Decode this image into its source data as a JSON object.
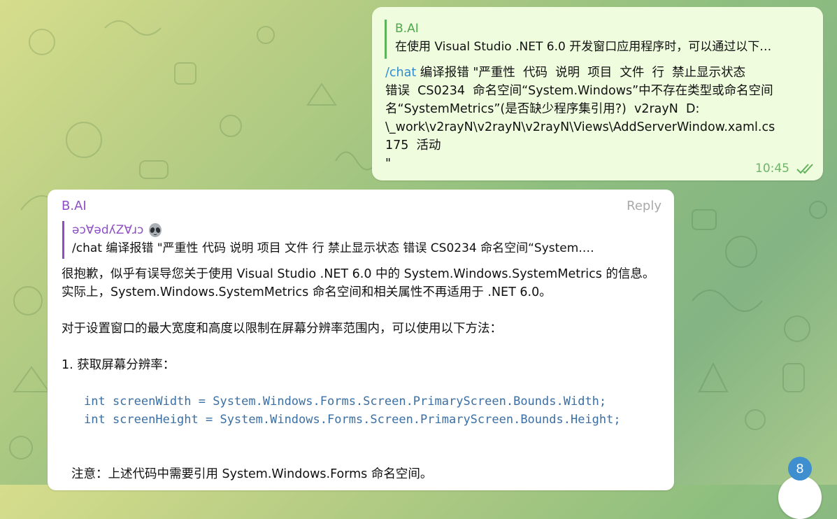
{
  "outgoing": {
    "quote_sender": "B.AI",
    "quote_text": "在使用 Visual Studio .NET 6.0 开发窗口应用程序时，可以通过以下…",
    "command": "/chat",
    "lines": [
      " 编译报错 \"严重性  代码  说明  项目  文件  行  禁止显示状态",
      "错误  CS0234  命名空间“System.Windows”中不存在类型或命名空间",
      "名“SystemMetrics”(是否缺少程序集引用?)  v2rayN  D:",
      "\\_work\\v2rayN\\v2rayN\\v2rayN\\Views\\AddServerWindow.xaml.cs",
      "175  活动",
      "\""
    ],
    "time": "10:45",
    "status_icon": "double-check-icon"
  },
  "incoming": {
    "sender": "B.AI",
    "reply_label": "Reply",
    "quote_sender": "ǝɔⱯǝdʎZⱯɹɔ",
    "quote_emoji_icon": "alien-icon",
    "quote_text": "/chat 编译报错 \"严重性  代码  说明  项目  文件  行  禁止显示状态 错误  CS0234  命名空间“System.…",
    "para1": "很抱歉，似乎有误导您关于使用 Visual Studio .NET 6.0 中的 System.Windows.SystemMetrics 的信息。实际上，System.Windows.SystemMetrics 命名空间和相关属性不再适用于 .NET 6.0。",
    "para2": "对于设置窗口的最大宽度和高度以限制在屏幕分辨率范围内，可以使用以下方法：",
    "step1": "1. 获取屏幕分辨率：",
    "code": [
      "int screenWidth = System.Windows.Forms.Screen.PrimaryScreen.Bounds.Width;",
      "int screenHeight = System.Windows.Forms.Screen.PrimaryScreen.Bounds.Height;"
    ],
    "note": "注意：上述代码中需要引用 System.Windows.Forms 命名空间。"
  },
  "unread_count": "8",
  "colors": {
    "outgoing_bubble": "#effdde",
    "incoming_bubble": "#ffffff",
    "sender_purple": "#8e4fc6",
    "quote_green": "#4fa84c",
    "link_blue": "#2e8ccf",
    "badge_blue": "#3e8ed0",
    "code_blue": "#3b6fa3"
  }
}
